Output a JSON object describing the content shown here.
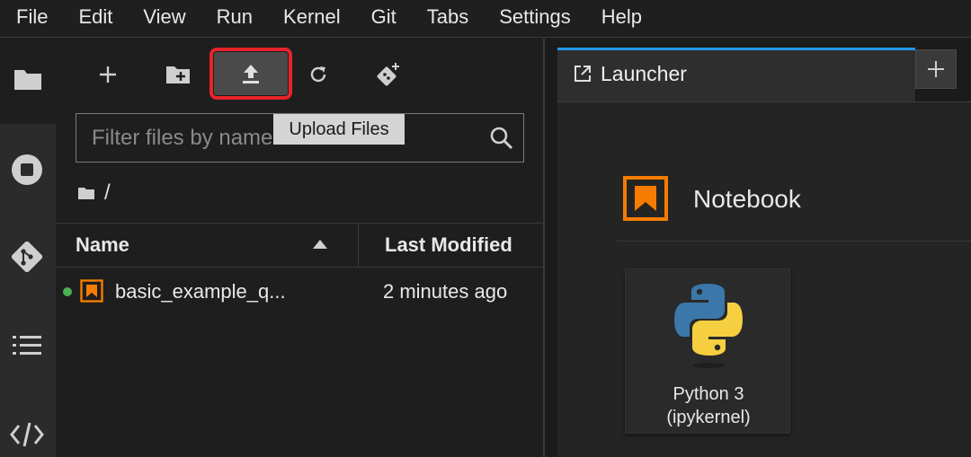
{
  "menu": [
    "File",
    "Edit",
    "View",
    "Run",
    "Kernel",
    "Git",
    "Tabs",
    "Settings",
    "Help"
  ],
  "filebrowser": {
    "filter_placeholder": "Filter files by name",
    "tooltip": "Upload Files",
    "breadcrumb": "/",
    "columns": {
      "name": "Name",
      "modified": "Last Modified"
    },
    "files": [
      {
        "name": "basic_example_q...",
        "modified": "2 minutes ago",
        "status_color": "#4caf50"
      }
    ]
  },
  "launcher": {
    "tab_label": "Launcher",
    "section": "Notebook",
    "kernel_line1": "Python 3",
    "kernel_line2": "(ipykernel)"
  },
  "colors": {
    "accent": "#2196f3",
    "highlight": "#e8232a",
    "notebook_orange": "#f57c00"
  }
}
